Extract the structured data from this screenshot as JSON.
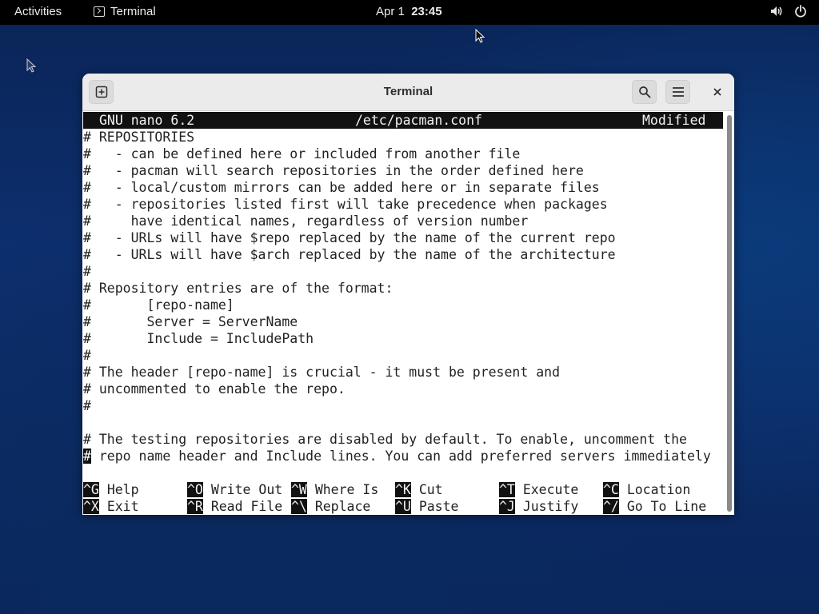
{
  "topbar": {
    "activities": "Activities",
    "app_name": "Terminal",
    "date": "Apr 1",
    "time": "23:45",
    "volume_icon": "speaker-icon",
    "power_icon": "power-icon"
  },
  "window": {
    "title": "Terminal",
    "new_tab_icon": "new-tab-icon",
    "search_icon": "search-icon",
    "menu_icon": "hamburger-menu-icon",
    "close_icon": "close-icon"
  },
  "nano": {
    "version": "GNU nano 6.2",
    "filename": "/etc/pacman.conf",
    "status": "Modified",
    "lines": [
      "# REPOSITORIES",
      "#   - can be defined here or included from another file",
      "#   - pacman will search repositories in the order defined here",
      "#   - local/custom mirrors can be added here or in separate files",
      "#   - repositories listed first will take precedence when packages",
      "#     have identical names, regardless of version number",
      "#   - URLs will have $repo replaced by the name of the current repo",
      "#   - URLs will have $arch replaced by the name of the architecture",
      "#",
      "# Repository entries are of the format:",
      "#       [repo-name]",
      "#       Server = ServerName",
      "#       Include = IncludePath",
      "#",
      "# The header [repo-name] is crucial - it must be present and",
      "# uncommented to enable the repo.",
      "#",
      "",
      "# The testing repositories are disabled by default. To enable, uncomment the",
      " repo name header and Include lines. You can add preferred servers immediately"
    ],
    "cursor_char": "#",
    "shortcuts": [
      {
        "key": "^G",
        "label": "Help"
      },
      {
        "key": "^O",
        "label": "Write Out"
      },
      {
        "key": "^W",
        "label": "Where Is"
      },
      {
        "key": "^K",
        "label": "Cut"
      },
      {
        "key": "^T",
        "label": "Execute"
      },
      {
        "key": "^C",
        "label": "Location"
      },
      {
        "key": "^X",
        "label": "Exit"
      },
      {
        "key": "^R",
        "label": "Read File"
      },
      {
        "key": "^\\",
        "label": "Replace"
      },
      {
        "key": "^U",
        "label": "Paste"
      },
      {
        "key": "^J",
        "label": "Justify"
      },
      {
        "key": "^/",
        "label": "Go To Line"
      }
    ]
  }
}
